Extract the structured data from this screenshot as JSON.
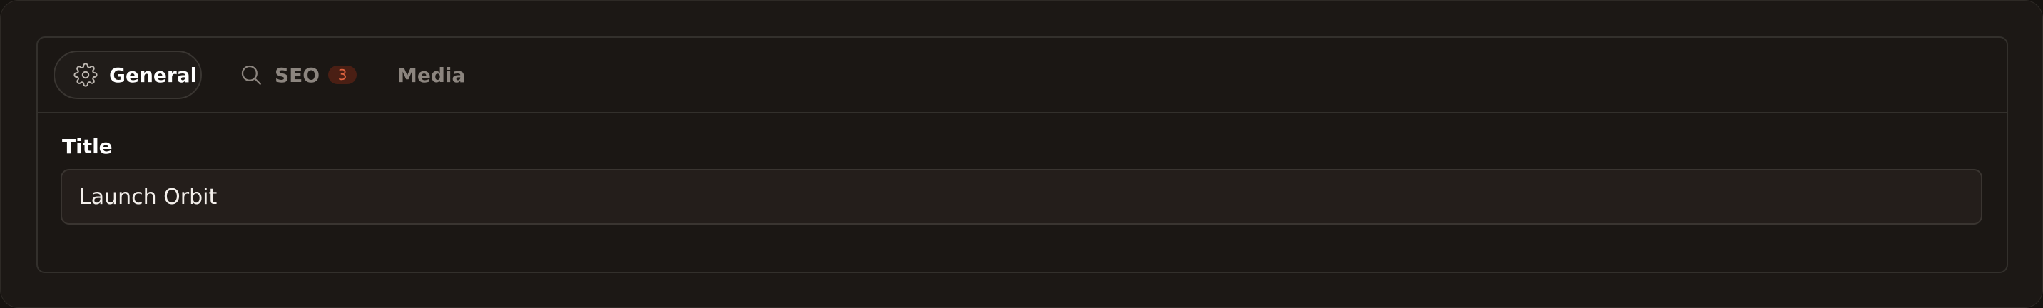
{
  "tabs": [
    {
      "label": "General",
      "icon": "gear-icon",
      "active": true
    },
    {
      "label": "SEO",
      "icon": "search-icon",
      "badge": "3",
      "active": false
    },
    {
      "label": "Media",
      "active": false
    }
  ],
  "form": {
    "title_label": "Title",
    "title_value": "Launch Orbit"
  },
  "colors": {
    "background": "#1c1815",
    "active_text": "#ffffff",
    "inactive_text": "#8c857f",
    "badge_bg": "#4a1f14",
    "badge_text": "#e0633f"
  }
}
